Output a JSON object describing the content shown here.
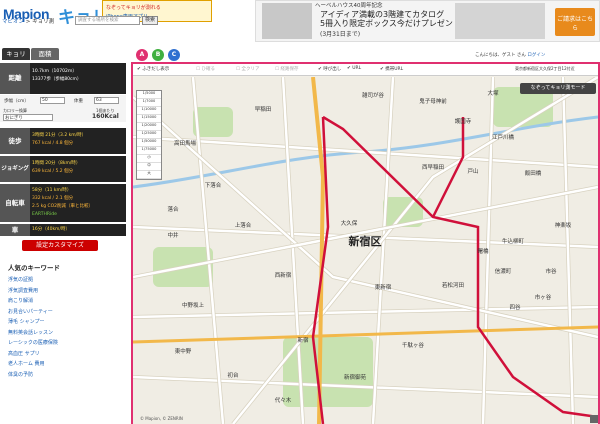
{
  "header": {
    "logo": "Mapion",
    "logo_sub": "キョリ測",
    "breadcrumb_home": "マピオン",
    "breadcrumb_sep": " > ",
    "breadcrumb_current": "キョリ測",
    "search_placeholder": "調査する場所を検索",
    "search_button": "検索",
    "banner_line1": "なぞってキョリが測れる",
    "banner_line2": "iPhone専用アプリ",
    "ad_head": "ヘーベルハウス40周年記念",
    "ad_line1": "アイディア満載の3階建てカタログ",
    "ad_line2": "5冊入り限定ボックス今だけプレゼント！",
    "ad_line3": "(3月31日まで)",
    "ad_cta": "ご請求はこちら"
  },
  "tabs": [
    {
      "label": "キョリ"
    },
    {
      "label": "面積"
    }
  ],
  "stats": {
    "distance": {
      "label": "距離",
      "lines": [
        "10.7km（10702ｍ）",
        "13377歩（歩幅80cm）"
      ]
    },
    "walk": {
      "label": "徒歩",
      "lines": [
        "3時間 21分（3.2 km/時）",
        "767 kcal / 4.8 個分"
      ]
    },
    "jog": {
      "label": "ジョギング",
      "lines": [
        "1時間 20分（8km/時）",
        "639 kcal / 5.2 個分"
      ]
    },
    "bike": {
      "label": "自転車",
      "lines": [
        "58分（11 km/時）",
        "332 kcal / 2.1 個分",
        "2.5 kg CO2削減（車と比較）",
        "EARTHRide"
      ]
    },
    "car": {
      "label": "車",
      "lines": [
        "16分（40km/時）"
      ]
    }
  },
  "settings": {
    "pace_label": "歩幅（cm）",
    "pace_value": "50",
    "weight_label": "体重",
    "weight_value": "63",
    "cal_label": "カロリー換算",
    "cal_value": "おにぎり",
    "cal_out1": "1個あたり",
    "cal_out2": "160Kcal"
  },
  "custom_button": "設定カスタマイズ",
  "keywords": {
    "title": "人気のキーワード",
    "items": [
      "浮気の証拠",
      "浮気調査費用",
      "肩こり解消",
      "お見合いパーティー",
      "薄毛 シャンプー",
      "無料英会話レッスン",
      "レーシックの医療保険",
      "高血圧 サプリ",
      "老人ホーム 費用",
      "体臭の予防"
    ]
  },
  "route_tabs": [
    "A",
    "B",
    "C"
  ],
  "greeting": "こんにちは、ゲスト さん",
  "login": "ログイン",
  "toolbar": {
    "items": [
      {
        "label": "ふきだし表示",
        "active": true
      },
      {
        "label": "ひ確る",
        "active": false
      },
      {
        "label": "全クリア",
        "active": false
      },
      {
        "label": "経路保存",
        "active": false
      },
      {
        "label": "呼び出し",
        "active": true
      },
      {
        "label": "URL",
        "active": true
      },
      {
        "label": "携帯URL",
        "active": true
      }
    ],
    "address": "東京都新宿区大久保2丁目12付近"
  },
  "map": {
    "mode_button": "なぞってキョリ測モード",
    "zoom_levels": [
      "1/5000",
      "1/7000",
      "1/10000",
      "1/15000",
      "1/20000",
      "1/25000",
      "1/50000",
      "1/75000",
      "小",
      "中",
      "大"
    ],
    "copyright": "© Mapion, © ZENRIN",
    "labels": [
      "新宿区",
      "早稲田",
      "高田馬場",
      "戸山",
      "大久保",
      "新宿御苑",
      "四谷",
      "市谷",
      "神楽坂",
      "落合",
      "東中野",
      "代々木",
      "西早稲田",
      "鬼子母神前",
      "雑司が谷",
      "大塚",
      "護国寺",
      "江戸川橋",
      "飯田橋",
      "市ヶ谷",
      "中野坂上",
      "初台",
      "千駄ヶ谷",
      "信濃町",
      "曙橋",
      "若松河田",
      "牛込柳町",
      "東新宿",
      "西新宿",
      "新宿",
      "上落合",
      "下落合",
      "中井"
    ],
    "colors": {
      "route": "#d0103a",
      "road": "#ffffff",
      "river": "#9cc8e8",
      "park": "#c8e2b0"
    }
  }
}
